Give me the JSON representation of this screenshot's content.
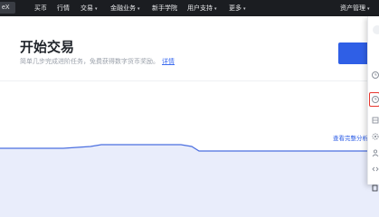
{
  "nav": {
    "logo": "eX",
    "items": [
      {
        "label": "买币",
        "caret": ""
      },
      {
        "label": "行情",
        "caret": ""
      },
      {
        "label": "交易",
        "caret": "▾"
      },
      {
        "label": "金融业务",
        "caret": "▾"
      },
      {
        "label": "新手学院",
        "caret": ""
      },
      {
        "label": "用户支持",
        "caret": "▾"
      },
      {
        "label": "更多",
        "caret": "▾"
      }
    ],
    "asset_mgmt": "资产管理",
    "asset_caret": "▾"
  },
  "header": {
    "title": "开始交易",
    "subtitle": "简单几步完成进阶任务，免费获得数字货币奖励。",
    "detail_link": "详情"
  },
  "analysis_link": "查看完整分析",
  "dropdown": {
    "icons": [
      "avatar-icon",
      "clock-icon",
      "clock-icon",
      "table-icon",
      "gear-icon",
      "person-icon",
      "code-icon",
      "logout-icon"
    ],
    "highlighted_index": 2
  },
  "colors": {
    "nav_bg": "#1b1d21",
    "accent": "#2f5fe6",
    "chart_line": "#4b6fe0",
    "chart_fill": "#e9edfb",
    "highlight": "#e8362e"
  }
}
